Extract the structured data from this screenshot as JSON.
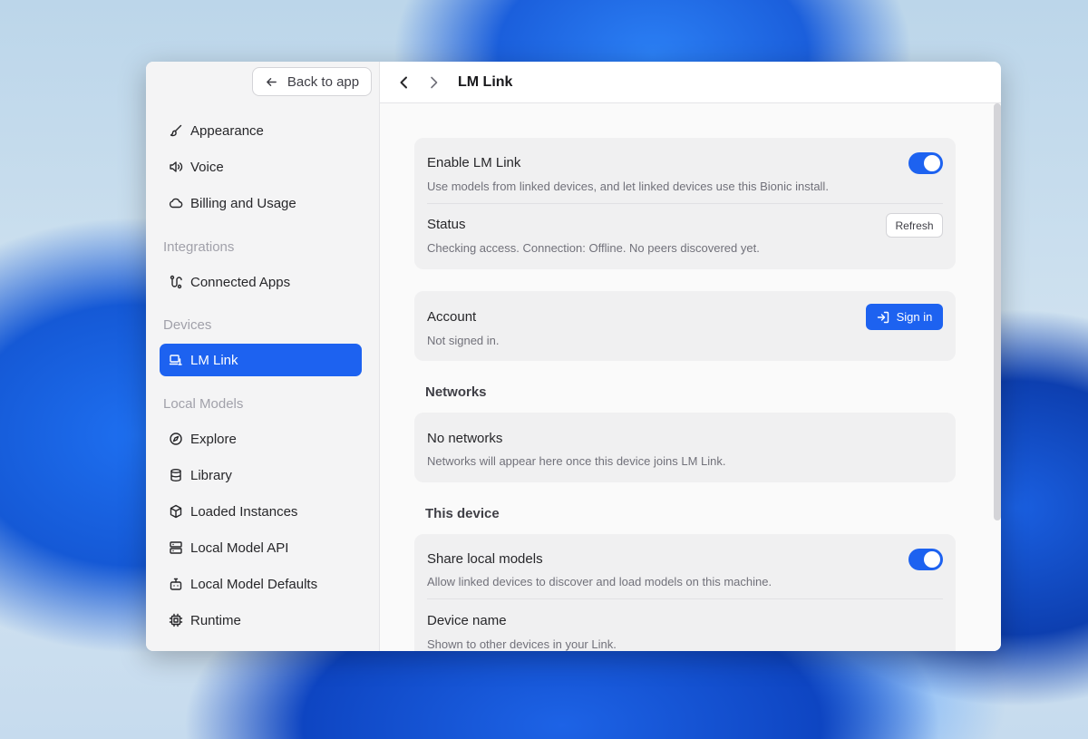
{
  "sidebar": {
    "back_label": "Back to app",
    "items_top": [
      {
        "label": "Appearance",
        "icon": "brush-icon"
      },
      {
        "label": "Voice",
        "icon": "speaker-icon"
      },
      {
        "label": "Billing and Usage",
        "icon": "cloud-icon"
      }
    ],
    "sections": {
      "integrations": "Integrations",
      "devices": "Devices",
      "local_models": "Local Models"
    },
    "connected_apps": {
      "label": "Connected Apps",
      "icon": "route-icon"
    },
    "lm_link": {
      "label": "LM Link",
      "icon": "devices-icon",
      "active": true
    },
    "local_items": [
      {
        "label": "Explore",
        "icon": "compass-icon"
      },
      {
        "label": "Library",
        "icon": "database-icon"
      },
      {
        "label": "Loaded Instances",
        "icon": "box-icon"
      },
      {
        "label": "Local Model API",
        "icon": "server-icon"
      },
      {
        "label": "Local Model Defaults",
        "icon": "bot-icon"
      },
      {
        "label": "Runtime",
        "icon": "cpu-icon"
      }
    ]
  },
  "header": {
    "title": "LM Link"
  },
  "link_card": {
    "enable_title": "Enable LM Link",
    "enable_desc": "Use models from linked devices, and let linked devices use this Bionic install.",
    "enabled": true,
    "status_title": "Status",
    "status_desc": "Checking access. Connection: Offline. No peers discovered yet.",
    "refresh_label": "Refresh"
  },
  "account_card": {
    "title": "Account",
    "desc": "Not signed in.",
    "signin_label": "Sign in"
  },
  "networks": {
    "heading": "Networks",
    "empty_title": "No networks",
    "empty_desc": "Networks will appear here once this device joins LM Link."
  },
  "this_device": {
    "heading": "This device",
    "share_title": "Share local models",
    "share_desc": "Allow linked devices to discover and load models on this machine.",
    "share_enabled": true,
    "device_name_title": "Device name",
    "device_name_desc": "Shown to other devices in your Link."
  },
  "colors": {
    "accent": "#1d62f0"
  }
}
